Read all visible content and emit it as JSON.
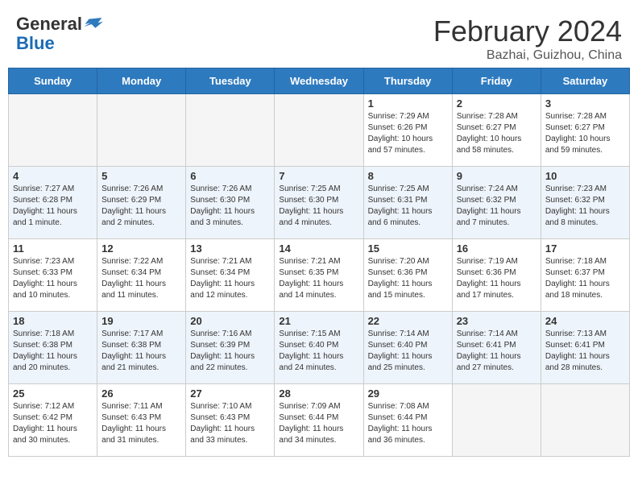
{
  "header": {
    "logo_general": "General",
    "logo_blue": "Blue",
    "month_title": "February 2024",
    "location": "Bazhai, Guizhou, China"
  },
  "days_of_week": [
    "Sunday",
    "Monday",
    "Tuesday",
    "Wednesday",
    "Thursday",
    "Friday",
    "Saturday"
  ],
  "weeks": [
    [
      {
        "day": "",
        "info": ""
      },
      {
        "day": "",
        "info": ""
      },
      {
        "day": "",
        "info": ""
      },
      {
        "day": "",
        "info": ""
      },
      {
        "day": "1",
        "info": "Sunrise: 7:29 AM\nSunset: 6:26 PM\nDaylight: 10 hours\nand 57 minutes."
      },
      {
        "day": "2",
        "info": "Sunrise: 7:28 AM\nSunset: 6:27 PM\nDaylight: 10 hours\nand 58 minutes."
      },
      {
        "day": "3",
        "info": "Sunrise: 7:28 AM\nSunset: 6:27 PM\nDaylight: 10 hours\nand 59 minutes."
      }
    ],
    [
      {
        "day": "4",
        "info": "Sunrise: 7:27 AM\nSunset: 6:28 PM\nDaylight: 11 hours\nand 1 minute."
      },
      {
        "day": "5",
        "info": "Sunrise: 7:26 AM\nSunset: 6:29 PM\nDaylight: 11 hours\nand 2 minutes."
      },
      {
        "day": "6",
        "info": "Sunrise: 7:26 AM\nSunset: 6:30 PM\nDaylight: 11 hours\nand 3 minutes."
      },
      {
        "day": "7",
        "info": "Sunrise: 7:25 AM\nSunset: 6:30 PM\nDaylight: 11 hours\nand 4 minutes."
      },
      {
        "day": "8",
        "info": "Sunrise: 7:25 AM\nSunset: 6:31 PM\nDaylight: 11 hours\nand 6 minutes."
      },
      {
        "day": "9",
        "info": "Sunrise: 7:24 AM\nSunset: 6:32 PM\nDaylight: 11 hours\nand 7 minutes."
      },
      {
        "day": "10",
        "info": "Sunrise: 7:23 AM\nSunset: 6:32 PM\nDaylight: 11 hours\nand 8 minutes."
      }
    ],
    [
      {
        "day": "11",
        "info": "Sunrise: 7:23 AM\nSunset: 6:33 PM\nDaylight: 11 hours\nand 10 minutes."
      },
      {
        "day": "12",
        "info": "Sunrise: 7:22 AM\nSunset: 6:34 PM\nDaylight: 11 hours\nand 11 minutes."
      },
      {
        "day": "13",
        "info": "Sunrise: 7:21 AM\nSunset: 6:34 PM\nDaylight: 11 hours\nand 12 minutes."
      },
      {
        "day": "14",
        "info": "Sunrise: 7:21 AM\nSunset: 6:35 PM\nDaylight: 11 hours\nand 14 minutes."
      },
      {
        "day": "15",
        "info": "Sunrise: 7:20 AM\nSunset: 6:36 PM\nDaylight: 11 hours\nand 15 minutes."
      },
      {
        "day": "16",
        "info": "Sunrise: 7:19 AM\nSunset: 6:36 PM\nDaylight: 11 hours\nand 17 minutes."
      },
      {
        "day": "17",
        "info": "Sunrise: 7:18 AM\nSunset: 6:37 PM\nDaylight: 11 hours\nand 18 minutes."
      }
    ],
    [
      {
        "day": "18",
        "info": "Sunrise: 7:18 AM\nSunset: 6:38 PM\nDaylight: 11 hours\nand 20 minutes."
      },
      {
        "day": "19",
        "info": "Sunrise: 7:17 AM\nSunset: 6:38 PM\nDaylight: 11 hours\nand 21 minutes."
      },
      {
        "day": "20",
        "info": "Sunrise: 7:16 AM\nSunset: 6:39 PM\nDaylight: 11 hours\nand 22 minutes."
      },
      {
        "day": "21",
        "info": "Sunrise: 7:15 AM\nSunset: 6:40 PM\nDaylight: 11 hours\nand 24 minutes."
      },
      {
        "day": "22",
        "info": "Sunrise: 7:14 AM\nSunset: 6:40 PM\nDaylight: 11 hours\nand 25 minutes."
      },
      {
        "day": "23",
        "info": "Sunrise: 7:14 AM\nSunset: 6:41 PM\nDaylight: 11 hours\nand 27 minutes."
      },
      {
        "day": "24",
        "info": "Sunrise: 7:13 AM\nSunset: 6:41 PM\nDaylight: 11 hours\nand 28 minutes."
      }
    ],
    [
      {
        "day": "25",
        "info": "Sunrise: 7:12 AM\nSunset: 6:42 PM\nDaylight: 11 hours\nand 30 minutes."
      },
      {
        "day": "26",
        "info": "Sunrise: 7:11 AM\nSunset: 6:43 PM\nDaylight: 11 hours\nand 31 minutes."
      },
      {
        "day": "27",
        "info": "Sunrise: 7:10 AM\nSunset: 6:43 PM\nDaylight: 11 hours\nand 33 minutes."
      },
      {
        "day": "28",
        "info": "Sunrise: 7:09 AM\nSunset: 6:44 PM\nDaylight: 11 hours\nand 34 minutes."
      },
      {
        "day": "29",
        "info": "Sunrise: 7:08 AM\nSunset: 6:44 PM\nDaylight: 11 hours\nand 36 minutes."
      },
      {
        "day": "",
        "info": ""
      },
      {
        "day": "",
        "info": ""
      }
    ]
  ]
}
